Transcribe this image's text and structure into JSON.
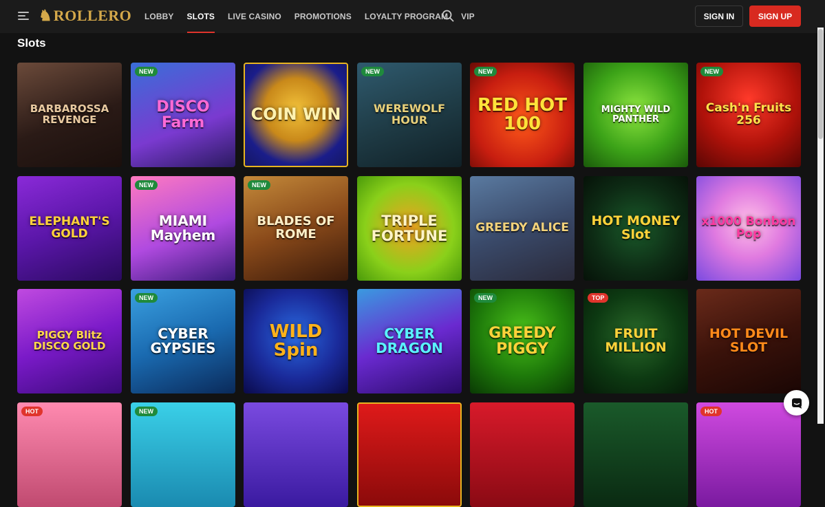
{
  "header": {
    "logo_mark": "♞",
    "logo_text": "ROLLERO",
    "nav": [
      "LOBBY",
      "SLOTS",
      "LIVE CASINO",
      "PROMOTIONS",
      "LOYALTY PROGRAM",
      "VIP"
    ],
    "active_nav": "SLOTS",
    "sign_in": "SIGN IN",
    "sign_up": "SIGN UP"
  },
  "page": {
    "title": "Slots"
  },
  "games": [
    {
      "name": "BARBAROSSA REVENGE",
      "badge": "",
      "bg": "linear-gradient(160deg,#6b4a3a,#2a1a16 55%,#1a0f0c)",
      "color": "#e8c9a0",
      "size": 15
    },
    {
      "name": "DISCO Farm",
      "badge": "NEW",
      "bg": "linear-gradient(160deg,#3a6ed8,#7a3ad0 60%,#2a1a60)",
      "color": "#ff6ad5",
      "size": 22
    },
    {
      "name": "COIN WIN",
      "badge": "",
      "bg": "radial-gradient(circle at 50% 45%,#f2c23a,#c9891a 40%,#1a1d8a 70%,#14165e)",
      "color": "#fff2b0",
      "size": 24,
      "selected": true
    },
    {
      "name": "WEREWOLF HOUR",
      "badge": "NEW",
      "bg": "linear-gradient(160deg,#2f5a6e,#1e3a44 55%,#102026)",
      "color": "#e8d07a",
      "size": 16
    },
    {
      "name": "RED HOT 100",
      "badge": "NEW",
      "bg": "radial-gradient(circle at 50% 55%,#ff5a1a,#c81e10 60%,#6a0a05)",
      "color": "#ffe23a",
      "size": 26
    },
    {
      "name": "MIGHTY WILD PANTHER",
      "badge": "",
      "bg": "radial-gradient(circle at 50% 45%,#8ee640,#3ca318 55%,#1a5a0a)",
      "color": "#fff",
      "size": 13
    },
    {
      "name": "Cash'n Fruits 256",
      "badge": "NEW",
      "bg": "radial-gradient(circle at 50% 35%,#ff3a2a,#b0120a 55%,#5a0604)",
      "color": "#ffe24a",
      "size": 17
    },
    {
      "name": "ELEPHANT'S GOLD",
      "badge": "",
      "bg": "linear-gradient(160deg,#8a2ad8,#5a16a8 50%,#2a0a60)",
      "color": "#ffd23a",
      "size": 17
    },
    {
      "name": "MIAMI Mayhem",
      "badge": "NEW",
      "bg": "linear-gradient(160deg,#ff7ac0,#b04ae0 55%,#3a1a7a)",
      "color": "#fff",
      "size": 20
    },
    {
      "name": "BLADES OF ROME",
      "badge": "NEW",
      "bg": "linear-gradient(160deg,#c48a3a,#8a4a1a 50%,#3a1a0a)",
      "color": "#fff0c8",
      "size": 18
    },
    {
      "name": "TRIPLE FORTUNE",
      "badge": "",
      "bg": "radial-gradient(circle at 50% 50%,#f2a020,#8ad01a 60%,#4a9a0a)",
      "color": "#fff4c8",
      "size": 21
    },
    {
      "name": "GREEDY ALICE",
      "badge": "",
      "bg": "linear-gradient(160deg,#5a7aa0,#3a4a6a 50%,#2a2a3a)",
      "color": "#f2d27a",
      "size": 17
    },
    {
      "name": "HOT MONEY Slot",
      "badge": "",
      "bg": "radial-gradient(circle at 50% 50%,#1a5a2a,#0d2a14 60%,#061208)",
      "color": "#ffd23a",
      "size": 19
    },
    {
      "name": "x1000 Bonbon Pop",
      "badge": "",
      "bg": "radial-gradient(circle at 50% 45%,#ffc0e8,#e07ae0 45%,#7a4ae0)",
      "color": "#ff3aa0",
      "size": 17
    },
    {
      "name": "PIGGY Blitz DISCO GOLD",
      "badge": "",
      "bg": "linear-gradient(160deg,#c04ae0,#7a1ac8 50%,#3a0a7a)",
      "color": "#ffd84a",
      "size": 15
    },
    {
      "name": "CYBER GYPSIES",
      "badge": "NEW",
      "bg": "linear-gradient(160deg,#3aa0e0,#1a6ab0 50%,#0a2a5a)",
      "color": "#fff",
      "size": 20
    },
    {
      "name": "WILD Spin",
      "badge": "",
      "bg": "radial-gradient(circle at 50% 45%,#2a6ae0,#1a2a9a 55%,#0a0a4a)",
      "color": "#ffb21a",
      "size": 26
    },
    {
      "name": "CYBER DRAGON",
      "badge": "",
      "bg": "linear-gradient(160deg,#3a9ae0,#6a2ad0 50%,#2a0a6a)",
      "color": "#5af2ff",
      "size": 20
    },
    {
      "name": "GREEDY PIGGY",
      "badge": "NEW",
      "bg": "radial-gradient(circle at 50% 40%,#4ac01a,#1e7a0a 55%,#0a3a04)",
      "color": "#ffd23a",
      "size": 22
    },
    {
      "name": "FRUIT MILLION",
      "badge": "TOP",
      "bg": "radial-gradient(circle at 50% 45%,#2a6a2a,#0d3a12 55%,#061a08)",
      "color": "#ffd23a",
      "size": 19
    },
    {
      "name": "HOT DEVIL SLOT",
      "badge": "",
      "bg": "linear-gradient(160deg,#6a2a1a,#3a120a 50%,#1a0604)",
      "color": "#ff8a1a",
      "size": 19
    },
    {
      "name": "",
      "badge": "HOT",
      "bg": "linear-gradient(180deg,#ff8ab0,#c04a70)",
      "color": "#fff",
      "size": 16
    },
    {
      "name": "",
      "badge": "NEW",
      "bg": "linear-gradient(180deg,#3ad0e8,#1a8ab0)",
      "color": "#fff",
      "size": 16
    },
    {
      "name": "",
      "badge": "",
      "bg": "linear-gradient(180deg,#7a4ae0,#3a1aa0)",
      "color": "#fff",
      "size": 16
    },
    {
      "name": "",
      "badge": "",
      "bg": "linear-gradient(180deg,#e01a1a,#8a0a0a)",
      "color": "#fff",
      "size": 16,
      "selected": true
    },
    {
      "name": "",
      "badge": "",
      "bg": "linear-gradient(180deg,#d81a2a,#8a0a14)",
      "color": "#fff",
      "size": 16
    },
    {
      "name": "",
      "badge": "",
      "bg": "linear-gradient(180deg,#1a5a2a,#0a2a12)",
      "color": "#fff",
      "size": 16
    },
    {
      "name": "",
      "badge": "HOT",
      "bg": "linear-gradient(180deg,#d04ae0,#7a1aa0)",
      "color": "#fff",
      "size": 16
    }
  ],
  "colors": {
    "accent": "#d82a20",
    "background": "#121212",
    "header": "#1b1b1b",
    "selected_outline": "#e8b520"
  },
  "icons": {
    "menu": "menu-icon",
    "search": "search-icon",
    "chat": "chat-icon"
  }
}
